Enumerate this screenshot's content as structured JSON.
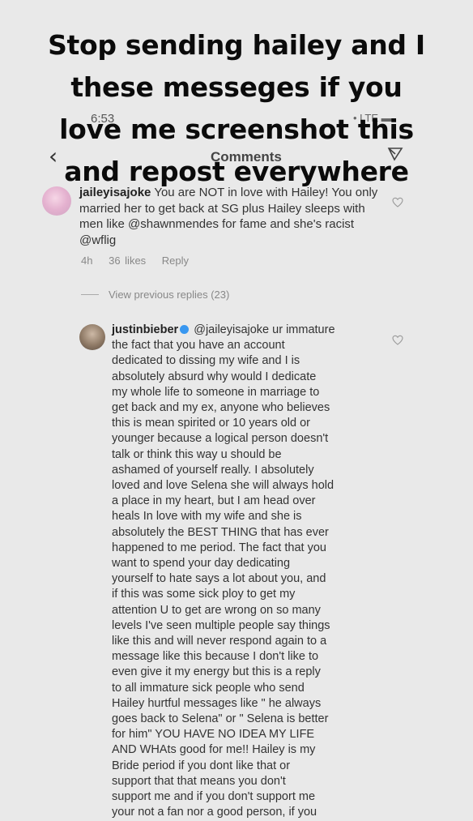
{
  "overlay": {
    "lines": [
      "Stop sending hailey and I",
      "these messeges if you",
      "love me screenshot this",
      "and repost everywhere"
    ]
  },
  "status_bar": {
    "time": "6:53",
    "right": "• LTE ▬"
  },
  "nav": {
    "back_icon": "chevron-left-icon",
    "title": "Comments",
    "send_icon": "paper-plane-icon"
  },
  "comments": [
    {
      "username": "jaileyisajoke",
      "text": "You are NOT in love with Hailey! You only married her to get back at SG plus Hailey sleeps with men like @shawnmendes for fame and she's racist @wflig",
      "time": "4h",
      "likes": "36 likes",
      "reply": "Reply"
    }
  ],
  "view_replies": "View previous replies (23)",
  "reply_comment": {
    "username": "justinbieber",
    "mention": "@jaileyisajoke",
    "lines": [
      "ur immature",
      "the fact that you have an account",
      "dedicated to dissing my wife and I is",
      "absolutely absurd why would I dedicate",
      "my whole life to someone in marriage to",
      "get back and my ex, anyone who believes",
      "this is mean spirited or 10 years old or",
      "younger because a logical person doesn't",
      "talk or think this way u should be",
      "ashamed of yourself really.  I absolutely",
      "loved and love Selena she will always hold",
      "a place in my heart, but I am head over",
      "heals In love with my wife and she is",
      "absolutely the BEST THING that has ever",
      "happened to me period. The fact that you",
      "want to spend your day dedicating",
      "yourself to hate says a lot about you, and",
      "if this was some sick ploy to get my",
      "attention U to get are wrong on so many",
      "levels I've seen multiple people say things",
      "like this and will never respond again to a",
      "message like this because I don't like to",
      "even give it my energy but this is a reply",
      "to all immature sick people who send",
      "Hailey hurtful messages like \" he always",
      "goes back to Selena\" or \" Selena is better",
      "for him\" YOU HAVE NO IDEA MY LIFE",
      "AND WHAts good for me!! Hailey is my",
      "Bride period if you dont like that or",
      "support that that means you don't",
      "support me and if you don't support me",
      "your not a fan nor a good person, if you"
    ]
  }
}
